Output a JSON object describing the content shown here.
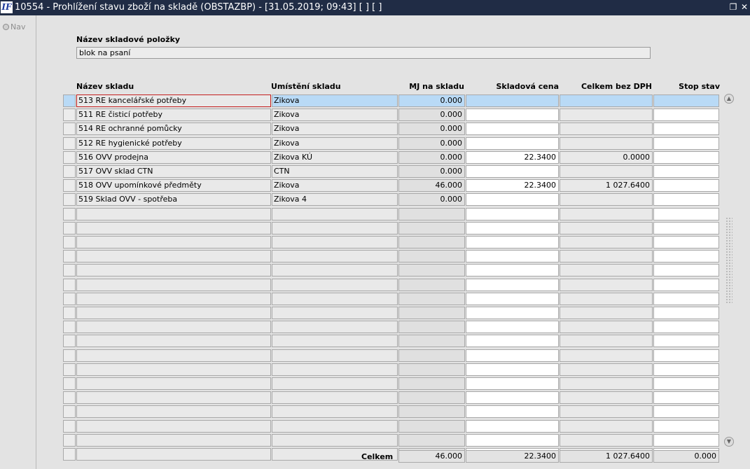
{
  "window": {
    "logo": "IF",
    "title": "10554 - Prohlížení stavu zboží na skladě (OBSTAZBP) - [31.05.2019; 09:43]  [ ]  [ ]",
    "restore_glyph": "❐",
    "close_glyph": "✕"
  },
  "nav": {
    "label": "Nav"
  },
  "item": {
    "label": "Název skladové položky",
    "value": "blok na psaní"
  },
  "table": {
    "headers": {
      "name": "Název skladu",
      "location": "Umístění skladu",
      "mj": "MJ na skladu",
      "price": "Skladová cena",
      "total": "Celkem bez DPH",
      "stop": "Stop stav"
    },
    "rows": [
      {
        "name": "513 RE kancelářské potřeby",
        "location": "Zikova",
        "mj": "0.000",
        "price": "",
        "total": "",
        "stop": ""
      },
      {
        "name": "511 RE čisticí potřeby",
        "location": "Zikova",
        "mj": "0.000",
        "price": "",
        "total": "",
        "stop": ""
      },
      {
        "name": "514 RE ochranné pomůcky",
        "location": "Zikova",
        "mj": "0.000",
        "price": "",
        "total": "",
        "stop": ""
      },
      {
        "name": "512 RE hygienické potřeby",
        "location": "Zikova",
        "mj": "0.000",
        "price": "",
        "total": "",
        "stop": ""
      },
      {
        "name": "516 OVV prodejna",
        "location": "Zikova KÚ",
        "mj": "0.000",
        "price": "22.3400",
        "total": "0.0000",
        "stop": ""
      },
      {
        "name": "517 OVV sklad CTN",
        "location": "CTN",
        "mj": "0.000",
        "price": "",
        "total": "",
        "stop": ""
      },
      {
        "name": "518 OVV upomínkové předměty",
        "location": "Zikova",
        "mj": "46.000",
        "price": "22.3400",
        "total": "1 027.6400",
        "stop": ""
      },
      {
        "name": "519 Sklad OVV - spotřeba",
        "location": "Zikova 4",
        "mj": "0.000",
        "price": "",
        "total": "",
        "stop": ""
      },
      {
        "name": "",
        "location": "",
        "mj": "",
        "price": "",
        "total": "",
        "stop": ""
      },
      {
        "name": "",
        "location": "",
        "mj": "",
        "price": "",
        "total": "",
        "stop": ""
      },
      {
        "name": "",
        "location": "",
        "mj": "",
        "price": "",
        "total": "",
        "stop": ""
      },
      {
        "name": "",
        "location": "",
        "mj": "",
        "price": "",
        "total": "",
        "stop": ""
      },
      {
        "name": "",
        "location": "",
        "mj": "",
        "price": "",
        "total": "",
        "stop": ""
      },
      {
        "name": "",
        "location": "",
        "mj": "",
        "price": "",
        "total": "",
        "stop": ""
      },
      {
        "name": "",
        "location": "",
        "mj": "",
        "price": "",
        "total": "",
        "stop": ""
      },
      {
        "name": "",
        "location": "",
        "mj": "",
        "price": "",
        "total": "",
        "stop": ""
      },
      {
        "name": "",
        "location": "",
        "mj": "",
        "price": "",
        "total": "",
        "stop": ""
      },
      {
        "name": "",
        "location": "",
        "mj": "",
        "price": "",
        "total": "",
        "stop": ""
      },
      {
        "name": "",
        "location": "",
        "mj": "",
        "price": "",
        "total": "",
        "stop": ""
      },
      {
        "name": "",
        "location": "",
        "mj": "",
        "price": "",
        "total": "",
        "stop": ""
      },
      {
        "name": "",
        "location": "",
        "mj": "",
        "price": "",
        "total": "",
        "stop": ""
      },
      {
        "name": "",
        "location": "",
        "mj": "",
        "price": "",
        "total": "",
        "stop": ""
      },
      {
        "name": "",
        "location": "",
        "mj": "",
        "price": "",
        "total": "",
        "stop": ""
      },
      {
        "name": "",
        "location": "",
        "mj": "",
        "price": "",
        "total": "",
        "stop": ""
      },
      {
        "name": "",
        "location": "",
        "mj": "",
        "price": "",
        "total": "",
        "stop": ""
      },
      {
        "name": "",
        "location": "",
        "mj": "",
        "price": "",
        "total": "",
        "stop": ""
      }
    ]
  },
  "totals": {
    "label": "Celkem",
    "mj": "46.000",
    "price": "22.3400",
    "total": "1 027.6400",
    "stop": "0.000"
  },
  "colors": {
    "titlebar": "#202c45",
    "selection": "#b9daf6",
    "current_cell_border": "#c31e1e"
  }
}
